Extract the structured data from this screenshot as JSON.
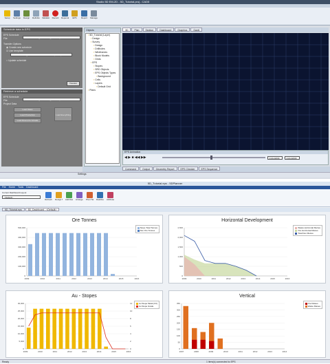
{
  "top_window": {
    "title": "Studio 5D EM-2D - 5D_Tutorial.proj - CAD5",
    "ribbon_buttons": [
      {
        "label": "Setup",
        "color": "#e8b800"
      },
      {
        "label": "Settings",
        "color": "#5c7fa8"
      },
      {
        "label": "Design",
        "color": "#6b8e3c"
      },
      {
        "label": "Definitions",
        "color": "#8fa3b8"
      },
      {
        "label": "Validation",
        "color": "#c05050"
      },
      {
        "label": "Record",
        "color": "#d02020"
      },
      {
        "label": "Dependencies",
        "color": "#3c6e9a"
      },
      {
        "label": "EPS",
        "color": "#d0a020"
      },
      {
        "label": "Report",
        "color": "#3a6ea5"
      },
      {
        "label": "Manage",
        "color": "#7a8a9c"
      }
    ],
    "left_panel": {
      "header": "Schedule data in EPS",
      "field1_label": "EPS Schedule File",
      "field1_value": "C:\\Datasets\\5D_Tutorial\\5D_Tutorial.eps",
      "section": "Transfer Options",
      "opt1": "Create new schedule",
      "opt2": "Use template",
      "template_value": "C:\\Datasets\\5D_Tutorial\\Benchmark\\EPS\\Template.eps",
      "opt3": "Update schedule",
      "button": "Transfer"
    },
    "left_panel2": {
      "header": "Retrieve a schedule",
      "field_label": "EPS Schedule File",
      "field_value": "C:\\Datasets\\5D_Tutorial\\5D_Tutorial.eps",
      "section": "Project Data",
      "btn1": "Load Dates",
      "btn2": "Load Production",
      "btn3": "Load Resource Actuals",
      "btn4": "Load Everything"
    },
    "tree_header": "Objects",
    "tree_items": [
      "5D_Tutorial (Layer)",
      "Design",
      "Survey",
      "Design",
      "Drillholes",
      "Wireframes",
      "Block Models",
      "Grids",
      "EPS",
      "Stopes",
      "SRD Objects",
      "EPS Objects Types",
      "Background",
      "Cells",
      "Layers",
      "Default Grid",
      "Plans"
    ],
    "view_tabs": [
      "3D",
      "Plan",
      "Section",
      "Dashboard",
      "Graphics",
      "Gantt"
    ],
    "animation_label": "EPS Animation",
    "date_start": "01/11/2009",
    "date_end": "01/11/2009",
    "bottom_tabs": [
      "Command",
      "Output",
      "Geometry Report",
      "EPS Checker",
      "EPS Sequence"
    ],
    "status_text": "Settings"
  },
  "bottom_window": {
    "title": "5D_Tutorial.eps - 5DPlanner",
    "menu": [
      "File",
      "Home",
      "Tools",
      "Dashboard"
    ],
    "sheet_label": "Current Dashboard Layout",
    "sheet_value": "<Default>",
    "ribbon_buttons": [
      "Refresh",
      "Design Mode",
      "Add Dashboard Item",
      "Arrange Items",
      "Pivot Table",
      "Dashboard",
      "Attributes"
    ],
    "doc_tabs": [
      "5D_Tutorial.eps",
      "5D_Dashboard - <Default>"
    ],
    "status_left": "Ready",
    "status_right": "1 item(s) connected to EPS"
  },
  "charts": {
    "ore_tonnes": {
      "title": "Ore Tonnes",
      "legend": [
        "Stope Total Tonnes",
        "Dev Ore Tonnes"
      ],
      "colors": [
        "#92b4de",
        "#4a7bc0"
      ],
      "x_labels": [
        "2009",
        "2010",
        "2011",
        "2012",
        "2013",
        "2014",
        "2015",
        "2016"
      ],
      "y_labels": [
        "500,000",
        "400,000",
        "300,000",
        "200,000",
        "100,000",
        "0"
      ],
      "ymax": 500000,
      "values": [
        330000,
        445000,
        445000,
        445000,
        445000,
        445000,
        445000,
        445000,
        445000,
        445000,
        445000,
        445000,
        20000,
        0,
        0,
        0
      ]
    },
    "horizontal_dev": {
      "title": "Horizontal Development",
      "legend": [
        "Waste Horizontal Metres",
        "Ore Horizontal Metres",
        "Total Dev Metres"
      ],
      "colors": [
        "#e8b4b0",
        "#c8d8a0",
        "#3b5ea8"
      ],
      "x_labels": [
        "2009",
        "2010",
        "2011",
        "2012",
        "2013",
        "2014",
        "2015",
        "2016"
      ],
      "y_labels": [
        "2,500",
        "2,000",
        "1,500",
        "1,000",
        "500",
        "0"
      ],
      "ymax": 2500,
      "total": [
        2100,
        1800,
        800,
        650,
        650,
        500,
        300,
        0
      ],
      "ore": [
        1100,
        850,
        650,
        650,
        650,
        500,
        300,
        0
      ],
      "waste": [
        1000,
        600,
        0,
        0,
        0,
        0,
        0,
        0
      ]
    },
    "au_stopes": {
      "title": "Au - Stopes",
      "legend": [
        "Au Stope Metal (Oz)",
        "Au Stope Grade"
      ],
      "colors": [
        "#f0b800",
        "#e03020"
      ],
      "x_labels": [
        "2009",
        "2010",
        "2011",
        "2012",
        "2013",
        "2014",
        "2015",
        "2016"
      ],
      "y_labels": [
        "30,000",
        "25,000",
        "20,000",
        "15,000",
        "10,000",
        "5,000",
        "0"
      ],
      "y2_labels": [
        "12",
        "10",
        "8",
        "6",
        "4",
        "2",
        "0"
      ],
      "ymax": 30000,
      "values": [
        14000,
        26500,
        26500,
        26500,
        26500,
        26500,
        26500,
        26500,
        26500,
        26500,
        26500,
        26500,
        1500,
        0,
        0,
        0
      ],
      "grade": [
        6,
        9,
        9.5,
        9.5,
        9.5,
        9.5,
        9.5,
        9.5,
        9.5,
        9.5,
        9.5,
        9.5,
        3,
        0,
        0,
        0
      ]
    },
    "vertical": {
      "title": "Vertical",
      "legend": [
        "Ore Raises",
        "Waste Raises"
      ],
      "colors": [
        "#c00000",
        "#e07020"
      ],
      "x_labels": [
        "2007",
        "2008",
        "2009",
        "2010",
        "2011",
        "2012",
        "2013",
        "2014"
      ],
      "y_labels": [
        "350",
        "300",
        "250",
        "200",
        "150",
        "100",
        "50",
        "0"
      ],
      "ymax": 350,
      "ore": [
        0,
        70,
        70,
        60,
        0,
        0,
        0,
        0,
        0,
        0,
        0,
        0
      ],
      "waste": [
        330,
        160,
        130,
        200,
        80,
        0,
        0,
        0,
        0,
        0,
        0,
        0
      ]
    }
  }
}
